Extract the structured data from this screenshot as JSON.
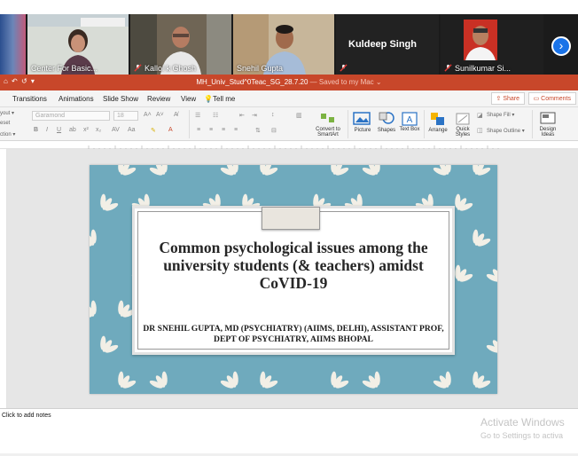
{
  "participants": [
    {
      "name": "Center For Basic...",
      "muted": false
    },
    {
      "name": "Kallol k Ghosh",
      "muted": true
    },
    {
      "name": "Snehil Gupta",
      "muted": false
    },
    {
      "name": "Kuldeep Singh",
      "muted": true,
      "video": false
    },
    {
      "name": "Sunilkumar Si...",
      "muted": true
    }
  ],
  "window": {
    "quick_access": "⌂ ↶ ↺ ▾",
    "doc_title": "MH_Univ_Stud^0Teac_SG_28.7.20",
    "saved_status": " — Saved to my Mac ⌄"
  },
  "ribbon_tabs": [
    "Transitions",
    "Animations",
    "Slide Show",
    "Review",
    "View",
    "Tell me"
  ],
  "share_label": "Share",
  "comments_label": "Comments",
  "ribbon": {
    "left_labels": [
      "yout ▾",
      "eset",
      "ction ▾"
    ],
    "font_name": "Garamond",
    "font_size": "18",
    "convert_label": "Convert to SmartArt",
    "picture_label": "Picture",
    "shapes_label": "Shapes",
    "textbox_label": "Text Box",
    "arrange_label": "Arrange",
    "quick_styles_label": "Quick Styles",
    "shape_fill_label": "Shape Fill ▾",
    "shape_outline_label": "Shape Outline ▾",
    "design_ideas_label": "Design Ideas"
  },
  "slide": {
    "title": "Common psychological issues among the university students (& teachers) amidst CoVID-19",
    "subtitle": "DR SNEHIL GUPTA, MD (PSYCHIATRY) (AIIMS, DELHI), ASSISTANT PROF, DEPT OF PSYCHIATRY, AIIMS BHOPAL"
  },
  "notes_placeholder": "Click to add notes",
  "watermark": {
    "line1": "Activate Windows",
    "line2": "Go to Settings to activa"
  },
  "colors": {
    "accent": "#c8472a",
    "slide_bg": "#6faabd",
    "pattern": "#f2efe6"
  }
}
